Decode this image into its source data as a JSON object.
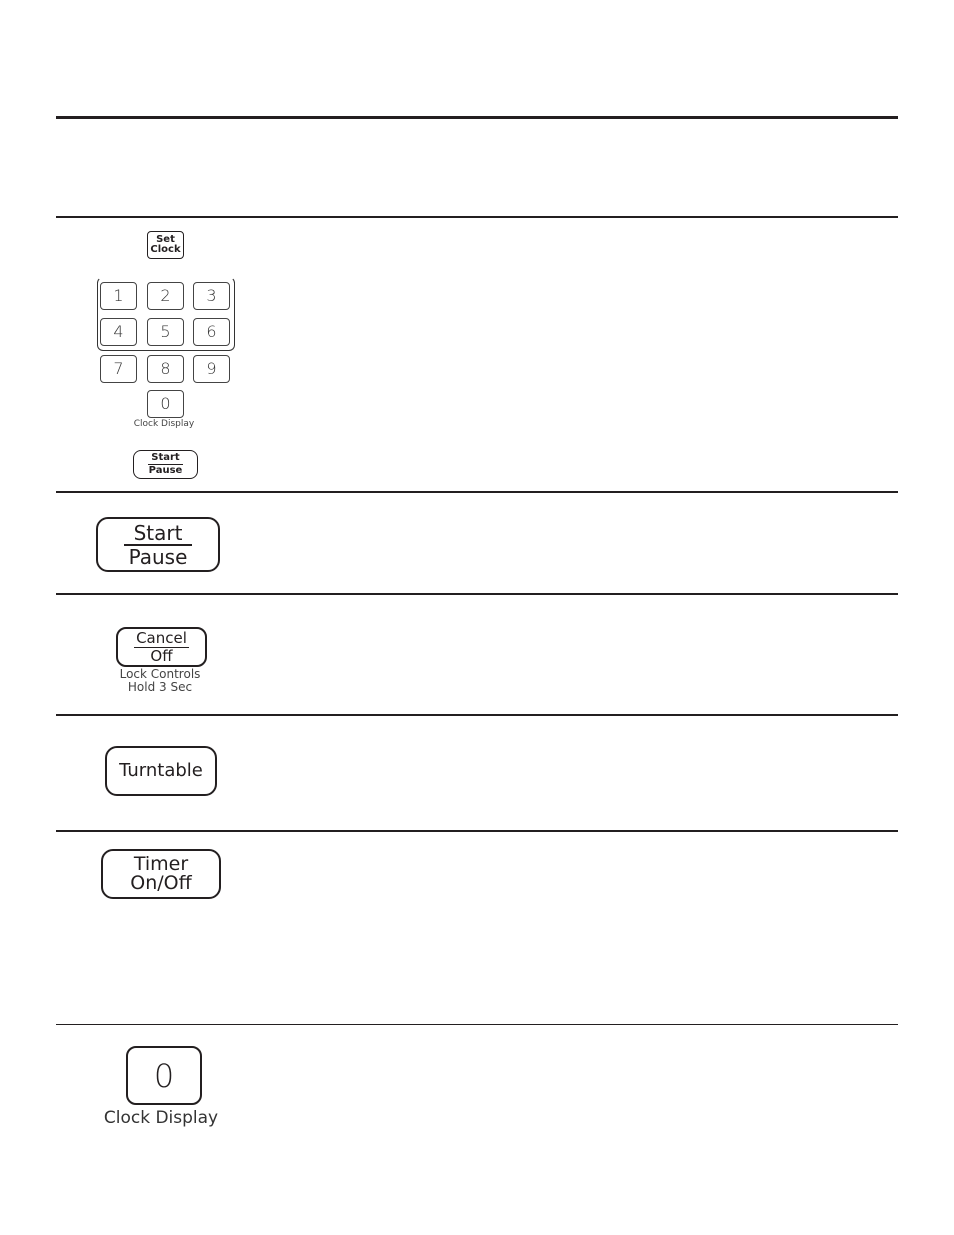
{
  "page": {
    "background": "#ffffff",
    "ink_color": "#231f20"
  },
  "rows": [
    {
      "id": "set-clock",
      "keys": {
        "set_clock": {
          "line1": "Set",
          "line2": "Clock"
        },
        "keypad": [
          "1",
          "2",
          "3",
          "4",
          "5",
          "6",
          "7",
          "8",
          "9",
          "0"
        ],
        "keypad_caption": "Clock Display",
        "start_pause": {
          "line1": "Start",
          "line2": "Pause"
        }
      }
    },
    {
      "id": "start-pause",
      "key": {
        "line1": "Start",
        "line2": "Pause"
      }
    },
    {
      "id": "cancel-off",
      "key": {
        "line1": "Cancel",
        "line2": "Off"
      },
      "caption_line1": "Lock Controls",
      "caption_line2": "Hold 3 Sec"
    },
    {
      "id": "turntable",
      "key": {
        "label": "Turntable"
      }
    },
    {
      "id": "timer",
      "key": {
        "line1": "Timer",
        "line2": "On/Off"
      }
    },
    {
      "id": "clock-display",
      "key": {
        "label": "0"
      },
      "caption": "Clock Display"
    }
  ]
}
